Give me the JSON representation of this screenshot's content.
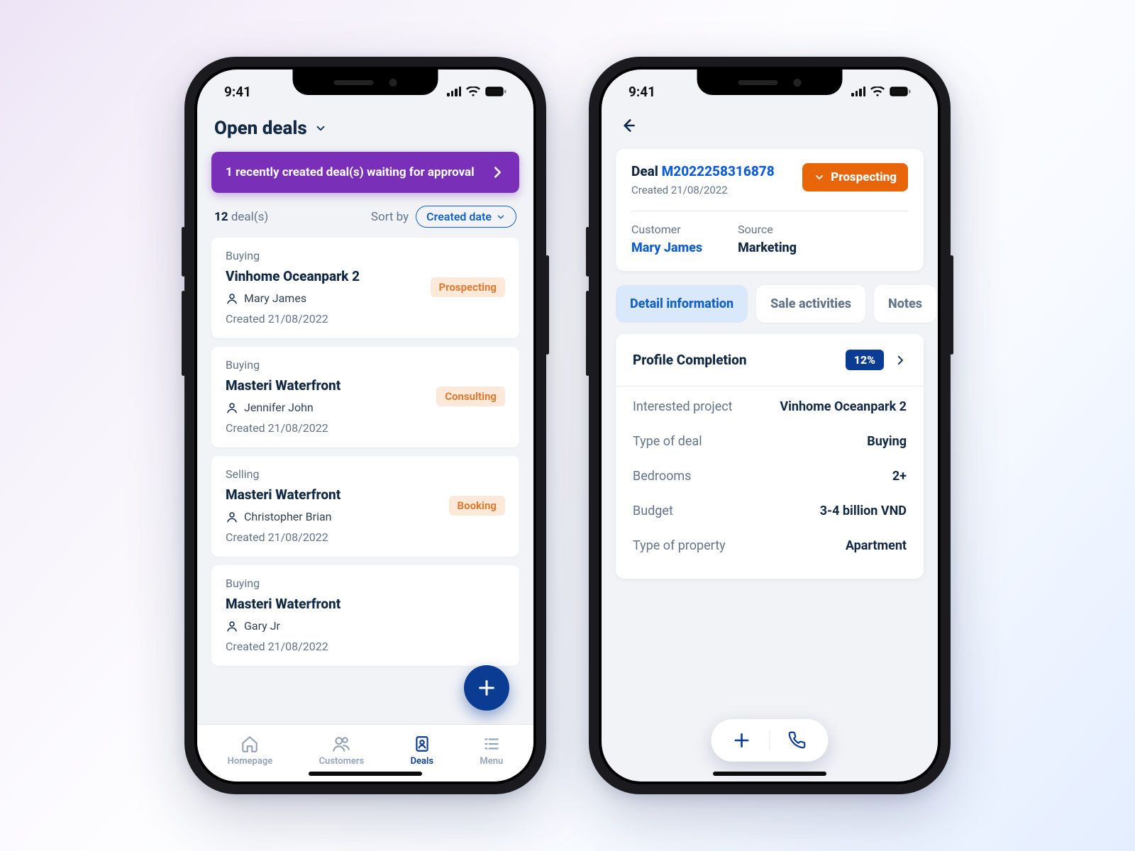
{
  "status_bar": {
    "time": "9:41"
  },
  "left": {
    "header_title": "Open deals",
    "banner_text": "1 recently created deal(s) waiting for approval",
    "count_number": "12",
    "count_label": "deal(s)",
    "sort_label": "Sort by",
    "sort_value": "Created date",
    "deals": [
      {
        "kind": "Buying",
        "title": "Vinhome Oceanpark 2",
        "person": "Mary James",
        "created": "Created 21/08/2022",
        "status": "Prospecting"
      },
      {
        "kind": "Buying",
        "title": "Masteri Waterfront",
        "person": "Jennifer John",
        "created": "Created 21/08/2022",
        "status": "Consulting"
      },
      {
        "kind": "Selling",
        "title": "Masteri Waterfront",
        "person": "Christopher Brian",
        "created": "Created 21/08/2022",
        "status": "Booking"
      },
      {
        "kind": "Buying",
        "title": "Masteri Waterfront",
        "person": "Gary Jr",
        "created": "Created 21/08/2022",
        "status": ""
      }
    ],
    "tabs": [
      {
        "label": "Homepage"
      },
      {
        "label": "Customers"
      },
      {
        "label": "Deals"
      },
      {
        "label": "Menu"
      }
    ],
    "active_tab": 2
  },
  "right": {
    "deal_prefix": "Deal ",
    "deal_id": "M2022258316878",
    "deal_created": "Created 21/08/2022",
    "status_label": "Prospecting",
    "kv": [
      {
        "label": "Customer",
        "value": "Mary James",
        "link": true
      },
      {
        "label": "Source",
        "value": "Marketing",
        "link": false
      }
    ],
    "tabs": [
      {
        "label": "Detail information",
        "active": true
      },
      {
        "label": "Sale activities",
        "active": false
      },
      {
        "label": "Notes",
        "active": false
      }
    ],
    "profile_completion": {
      "title": "Profile Completion",
      "value": "12%"
    },
    "details": [
      {
        "k": "Interested project",
        "v": "Vinhome Oceanpark 2"
      },
      {
        "k": "Type of deal",
        "v": "Buying"
      },
      {
        "k": "Bedrooms",
        "v": "2+"
      },
      {
        "k": "Budget",
        "v": "3-4 billion VND"
      },
      {
        "k": "Type of property",
        "v": "Apartment"
      }
    ]
  }
}
